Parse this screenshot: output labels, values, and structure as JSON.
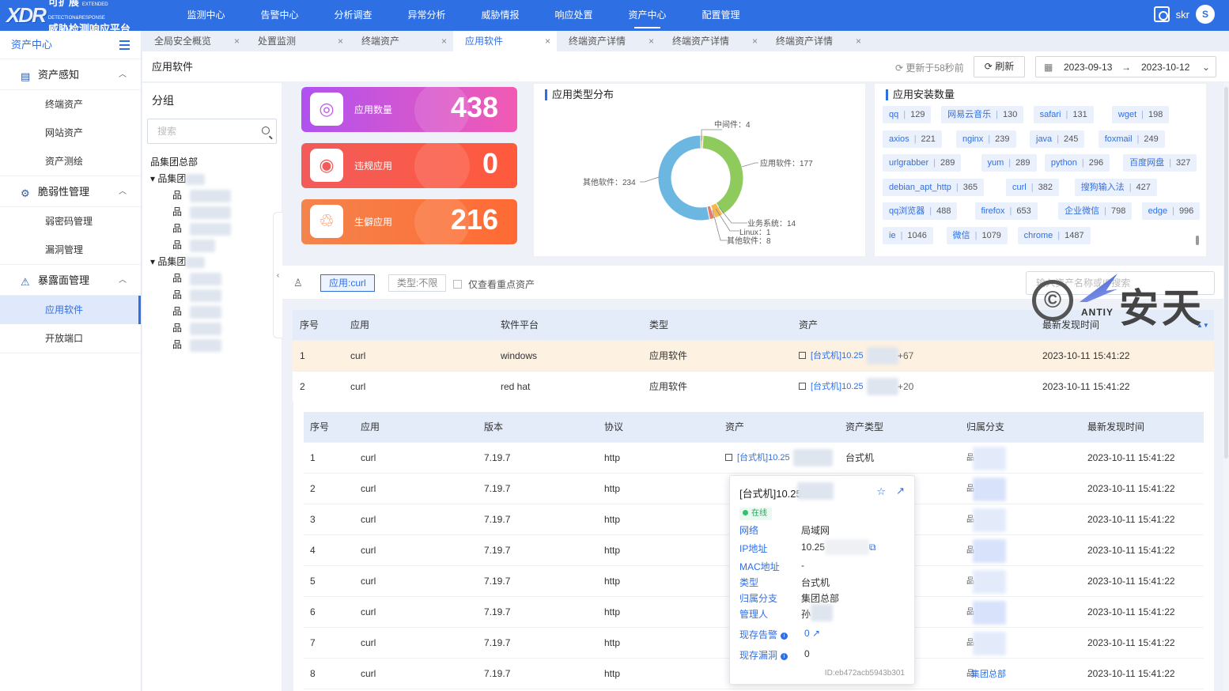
{
  "app": {
    "logo_main": "XDR",
    "logo_line1": "可扩展",
    "logo_line1_en": "EXTENDED DETECTION&RESPONSE",
    "logo_line2": "威胁检测响应平台",
    "user": "skr",
    "avatar": "S"
  },
  "topnav": [
    "监测中心",
    "告警中心",
    "分析调查",
    "异常分析",
    "威胁情报",
    "响应处置",
    "资产中心",
    "配置管理"
  ],
  "topnav_active": "资产中心",
  "sidebar": {
    "title": "资产中心",
    "groups": [
      {
        "label": "资产感知",
        "items": [
          "终端资产",
          "网站资产",
          "资产测绘"
        ]
      },
      {
        "label": "脆弱性管理",
        "items": [
          "弱密码管理",
          "漏洞管理"
        ]
      },
      {
        "label": "暴露面管理",
        "items": [
          "应用软件",
          "开放端口"
        ]
      }
    ],
    "active_item": "应用软件"
  },
  "tabs": [
    {
      "label": "全局安全概览"
    },
    {
      "label": "处置监测"
    },
    {
      "label": "终端资产"
    },
    {
      "label": "应用软件",
      "active": true
    },
    {
      "label": "终端资产详情"
    },
    {
      "label": "终端资产详情"
    },
    {
      "label": "终端资产详情"
    }
  ],
  "page": {
    "title": "应用软件",
    "updated": "更新于58秒前",
    "refresh": "刷新",
    "date_from": "2023-09-13",
    "date_to": "2023-10-12",
    "date_sep": "→"
  },
  "group_panel": {
    "title": "分组",
    "search_placeholder": "搜索",
    "root": "集团总部",
    "node1": "集团",
    "node2": "集团"
  },
  "cards": [
    {
      "label": "应用数量",
      "value": "438",
      "icon": "target-icon"
    },
    {
      "label": "违规应用",
      "value": "0",
      "icon": "bullseye-icon"
    },
    {
      "label": "生僻应用",
      "value": "216",
      "icon": "recycle-icon"
    }
  ],
  "donut": {
    "title": "应用类型分布",
    "labels": {
      "middleware": "中间件：4",
      "app": "应用软件：177",
      "other": "其他软件：234",
      "biz": "业务系统：14",
      "linux": "Linux：1",
      "other2": "其他软件：8"
    }
  },
  "chart_data": {
    "type": "pie",
    "title": "应用类型分布",
    "categories": [
      "中间件",
      "应用软件",
      "其他软件",
      "业务系统",
      "Linux",
      "其他软件"
    ],
    "values": [
      4,
      177,
      234,
      14,
      1,
      8
    ],
    "colors": [
      "#f2c94c",
      "#8ecb5c",
      "#6bb7e1",
      "#f6b84c",
      "#c2c2c2",
      "#e37c6d"
    ]
  },
  "install": {
    "title": "应用安装数量",
    "chips": [
      [
        "qq",
        "129"
      ],
      [
        "网易云音乐",
        "130"
      ],
      [
        "safari",
        "131"
      ],
      [
        "wget",
        "198"
      ],
      [
        "axios",
        "221"
      ],
      [
        "nginx",
        "239"
      ],
      [
        "java",
        "245"
      ],
      [
        "foxmail",
        "249"
      ],
      [
        "urlgrabber",
        "289"
      ],
      [
        "yum",
        "289"
      ],
      [
        "python",
        "296"
      ],
      [
        "百度网盘",
        "327"
      ],
      [
        "debian_apt_http",
        "365"
      ],
      [
        "curl",
        "382"
      ],
      [
        "搜狗输入法",
        "427"
      ],
      [
        "qq浏览器",
        "488"
      ],
      [
        "firefox",
        "653"
      ],
      [
        "企业微信",
        "798"
      ],
      [
        "edge",
        "996"
      ],
      [
        "ie",
        "1046"
      ],
      [
        "微信",
        "1079"
      ],
      [
        "chrome",
        "1487"
      ]
    ]
  },
  "filter": {
    "tag1": "应用:curl",
    "tag2": "类型:不限",
    "important_only": "仅查看重点资产",
    "search_placeholder": "输入资产名称或IP搜索"
  },
  "main_table": {
    "headers": [
      "序号",
      "应用",
      "软件平台",
      "类型",
      "资产",
      "最新发现时间"
    ],
    "rows": [
      {
        "no": "1",
        "app": "curl",
        "platform": "windows",
        "type": "应用软件",
        "asset": "[台式机]10.25",
        "plus": "+67",
        "time": "2023-10-11 15:41:22"
      },
      {
        "no": "2",
        "app": "curl",
        "platform": "red hat",
        "type": "应用软件",
        "asset": "[台式机]10.25",
        "plus": "+20",
        "time": "2023-10-11 15:41:22"
      }
    ]
  },
  "sub_table": {
    "headers": [
      "序号",
      "应用",
      "版本",
      "协议",
      "资产",
      "资产类型",
      "归属分支",
      "最新发现时间"
    ],
    "rows": [
      {
        "no": "1",
        "app": "curl",
        "ver": "7.19.7",
        "proto": "http",
        "asset": "[台式机]10.25",
        "atype": "台式机",
        "branch": "",
        "time": "2023-10-11 15:41:22"
      },
      {
        "no": "2",
        "app": "curl",
        "ver": "7.19.7",
        "proto": "http",
        "asset": "",
        "atype": "",
        "branch": "",
        "time": "2023-10-11 15:41:22"
      },
      {
        "no": "3",
        "app": "curl",
        "ver": "7.19.7",
        "proto": "http",
        "asset": "",
        "atype": "",
        "branch": "",
        "time": "2023-10-11 15:41:22"
      },
      {
        "no": "4",
        "app": "curl",
        "ver": "7.19.7",
        "proto": "http",
        "asset": "",
        "atype": "",
        "branch": "",
        "time": "2023-10-11 15:41:22"
      },
      {
        "no": "5",
        "app": "curl",
        "ver": "7.19.7",
        "proto": "http",
        "asset": "",
        "atype": "",
        "branch": "",
        "time": "2023-10-11 15:41:22"
      },
      {
        "no": "6",
        "app": "curl",
        "ver": "7.19.7",
        "proto": "http",
        "asset": "",
        "atype": "",
        "branch": "",
        "time": "2023-10-11 15:41:22"
      },
      {
        "no": "7",
        "app": "curl",
        "ver": "7.19.7",
        "proto": "http",
        "asset": "",
        "atype": "",
        "branch": "",
        "time": "2023-10-11 15:41:22"
      },
      {
        "no": "8",
        "app": "curl",
        "ver": "7.19.7",
        "proto": "http",
        "asset": "",
        "atype": "",
        "branch": "集团总部",
        "time": "2023-10-11 15:41:22"
      }
    ]
  },
  "popup": {
    "title": "[台式机]10.25",
    "status": "在线",
    "fields": [
      {
        "k": "网络",
        "v": "局域网"
      },
      {
        "k": "IP地址",
        "v": "10.25"
      },
      {
        "k": "MAC地址",
        "v": "-"
      },
      {
        "k": "类型",
        "v": "台式机"
      },
      {
        "k": "归属分支",
        "v": "集团总部"
      },
      {
        "k": "管理人",
        "v": "孙"
      }
    ],
    "alarm_label": "现存告警",
    "alarm_value": "0",
    "vuln_label": "现存漏洞",
    "vuln_value": "0",
    "id": "ID:eb472acb5943b301"
  },
  "watermark": {
    "cn": "安天",
    "en": "ANTIY",
    "mark": "©"
  }
}
